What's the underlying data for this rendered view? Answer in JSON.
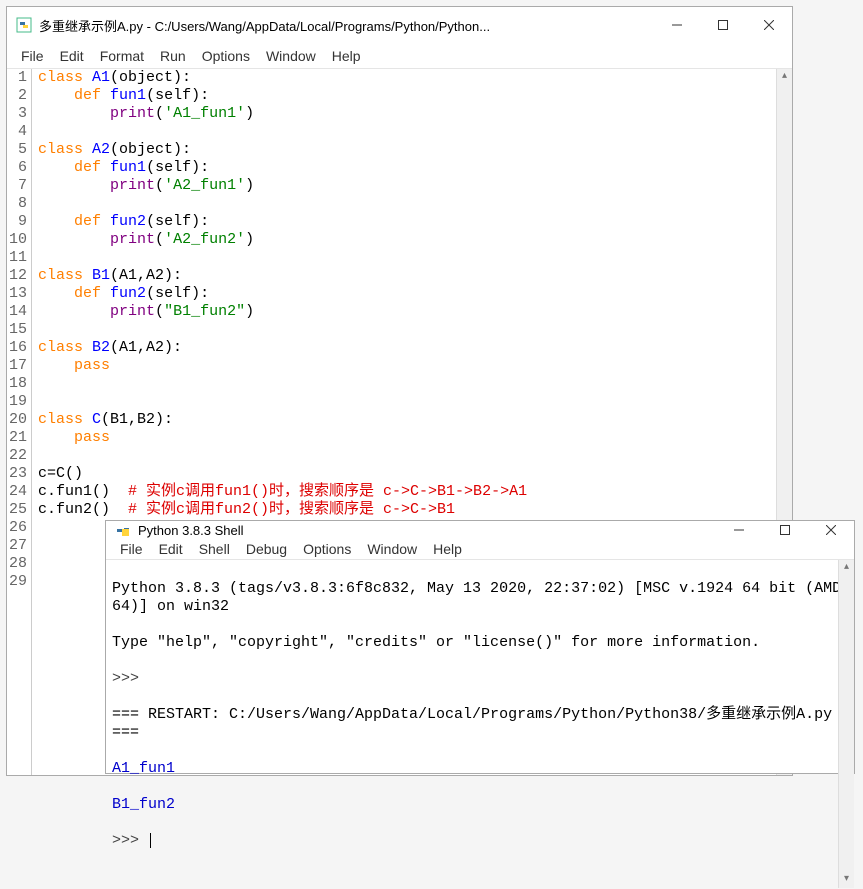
{
  "editor": {
    "title": "多重继承示例A.py - C:/Users/Wang/AppData/Local/Programs/Python/Python...",
    "menus": [
      "File",
      "Edit",
      "Format",
      "Run",
      "Options",
      "Window",
      "Help"
    ],
    "code": {
      "lines": [
        {
          "n": 1,
          "tokens": [
            {
              "t": "class ",
              "c": "kw"
            },
            {
              "t": "A1",
              "c": "def"
            },
            {
              "t": "(object):"
            }
          ]
        },
        {
          "n": 2,
          "tokens": [
            {
              "t": "    "
            },
            {
              "t": "def ",
              "c": "kw"
            },
            {
              "t": "fun1",
              "c": "def"
            },
            {
              "t": "(self):"
            }
          ]
        },
        {
          "n": 3,
          "tokens": [
            {
              "t": "        "
            },
            {
              "t": "print",
              "c": "prn"
            },
            {
              "t": "("
            },
            {
              "t": "'A1_fun1'",
              "c": "str"
            },
            {
              "t": ")"
            }
          ]
        },
        {
          "n": 4,
          "tokens": []
        },
        {
          "n": 5,
          "tokens": [
            {
              "t": "class ",
              "c": "kw"
            },
            {
              "t": "A2",
              "c": "def"
            },
            {
              "t": "(object):"
            }
          ]
        },
        {
          "n": 6,
          "tokens": [
            {
              "t": "    "
            },
            {
              "t": "def ",
              "c": "kw"
            },
            {
              "t": "fun1",
              "c": "def"
            },
            {
              "t": "(self):"
            }
          ]
        },
        {
          "n": 7,
          "tokens": [
            {
              "t": "        "
            },
            {
              "t": "print",
              "c": "prn"
            },
            {
              "t": "("
            },
            {
              "t": "'A2_fun1'",
              "c": "str"
            },
            {
              "t": ")"
            }
          ]
        },
        {
          "n": 8,
          "tokens": []
        },
        {
          "n": 9,
          "tokens": [
            {
              "t": "    "
            },
            {
              "t": "def ",
              "c": "kw"
            },
            {
              "t": "fun2",
              "c": "def"
            },
            {
              "t": "(self):"
            }
          ]
        },
        {
          "n": 10,
          "tokens": [
            {
              "t": "        "
            },
            {
              "t": "print",
              "c": "prn"
            },
            {
              "t": "("
            },
            {
              "t": "'A2_fun2'",
              "c": "str"
            },
            {
              "t": ")"
            }
          ]
        },
        {
          "n": 11,
          "tokens": []
        },
        {
          "n": 12,
          "tokens": [
            {
              "t": "class ",
              "c": "kw"
            },
            {
              "t": "B1",
              "c": "def"
            },
            {
              "t": "(A1,A2):"
            }
          ]
        },
        {
          "n": 13,
          "tokens": [
            {
              "t": "    "
            },
            {
              "t": "def ",
              "c": "kw"
            },
            {
              "t": "fun2",
              "c": "def"
            },
            {
              "t": "(self):"
            }
          ]
        },
        {
          "n": 14,
          "tokens": [
            {
              "t": "        "
            },
            {
              "t": "print",
              "c": "prn"
            },
            {
              "t": "("
            },
            {
              "t": "\"B1_fun2\"",
              "c": "str"
            },
            {
              "t": ")"
            }
          ]
        },
        {
          "n": 15,
          "tokens": []
        },
        {
          "n": 16,
          "tokens": [
            {
              "t": "class ",
              "c": "kw"
            },
            {
              "t": "B2",
              "c": "def"
            },
            {
              "t": "(A1,A2):"
            }
          ]
        },
        {
          "n": 17,
          "tokens": [
            {
              "t": "    "
            },
            {
              "t": "pass",
              "c": "kw"
            }
          ]
        },
        {
          "n": 18,
          "tokens": []
        },
        {
          "n": 19,
          "tokens": []
        },
        {
          "n": 20,
          "tokens": [
            {
              "t": "class ",
              "c": "kw"
            },
            {
              "t": "C",
              "c": "def"
            },
            {
              "t": "(B1,B2):"
            }
          ]
        },
        {
          "n": 21,
          "tokens": [
            {
              "t": "    "
            },
            {
              "t": "pass",
              "c": "kw"
            }
          ]
        },
        {
          "n": 22,
          "tokens": []
        },
        {
          "n": 23,
          "tokens": [
            {
              "t": "c=C()"
            }
          ]
        },
        {
          "n": 24,
          "tokens": [
            {
              "t": "c.fun1()  "
            },
            {
              "t": "# 实例c调用fun1()时，搜索顺序是 c->C->B1->B2->A1",
              "c": "cmt"
            }
          ]
        },
        {
          "n": 25,
          "tokens": [
            {
              "t": "c.fun2()  "
            },
            {
              "t": "# 实例c调用fun2()时，搜索顺序是 c->C->B1",
              "c": "cmt"
            }
          ]
        },
        {
          "n": 26,
          "tokens": []
        },
        {
          "n": 27,
          "tokens": []
        },
        {
          "n": 28,
          "tokens": []
        },
        {
          "n": 29,
          "tokens": []
        }
      ]
    }
  },
  "shell": {
    "title": "Python 3.8.3 Shell",
    "menus": [
      "File",
      "Edit",
      "Shell",
      "Debug",
      "Options",
      "Window",
      "Help"
    ],
    "banner1": "Python 3.8.3 (tags/v3.8.3:6f8c832, May 13 2020, 22:37:02) [MSC v.1924 64 bit (AMD64)] on win32",
    "banner2": "Type \"help\", \"copyright\", \"credits\" or \"license()\" for more information.",
    "prompt": ">>> ",
    "restart": "=== RESTART: C:/Users/Wang/AppData/Local/Programs/Python/Python38/多重继承示例A.py ===",
    "out1": "A1_fun1",
    "out2": "B1_fun2"
  }
}
